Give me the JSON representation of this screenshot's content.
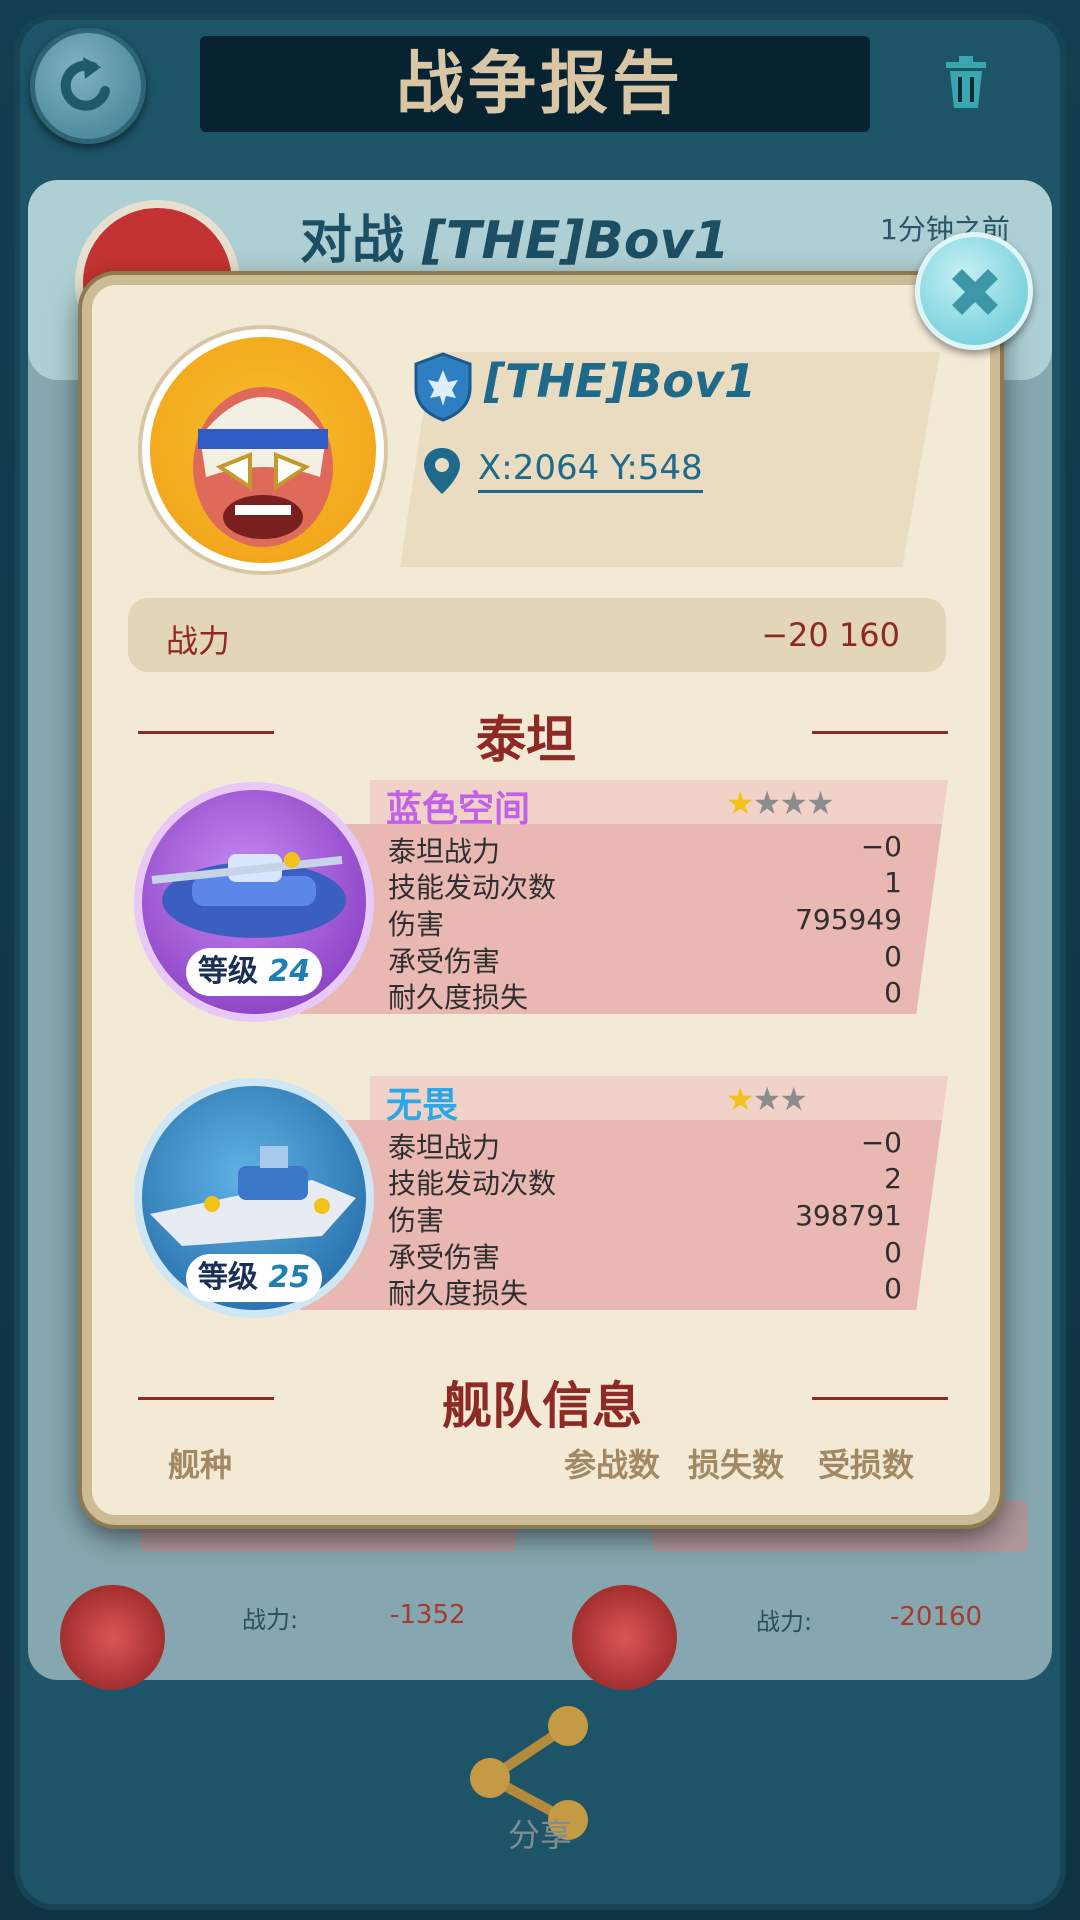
{
  "screen": {
    "title": "战争报告",
    "report_header": {
      "versus_prefix": "对战",
      "opponent": "[THE]Bov1",
      "time_ago": "1分钟之前"
    },
    "bottom_rows": [
      {
        "label": "战力:",
        "value": "-1352"
      },
      {
        "label": "战力:",
        "value": "-20160"
      }
    ],
    "share_label": "分享"
  },
  "popup": {
    "player_name": "[THE]Bov1",
    "coordinates": "X:2064 Y:548",
    "power_label": "战力",
    "power_value": "−20 160",
    "titan_section_title": "泰坦",
    "titans": [
      {
        "name": "蓝色空间",
        "name_color": "#c061e8",
        "stars_filled": 1,
        "stars_total": 4,
        "level_label": "等级",
        "level": "24",
        "stats": [
          {
            "label": "泰坦战力",
            "value": "−0"
          },
          {
            "label": "技能发动次数",
            "value": "1"
          },
          {
            "label": "伤害",
            "value": "795949"
          },
          {
            "label": "承受伤害",
            "value": "0"
          },
          {
            "label": "耐久度损失",
            "value": "0"
          }
        ]
      },
      {
        "name": "无畏",
        "name_color": "#2aa8e8",
        "stars_filled": 1,
        "stars_total": 3,
        "level_label": "等级",
        "level": "25",
        "stats": [
          {
            "label": "泰坦战力",
            "value": "−0"
          },
          {
            "label": "技能发动次数",
            "value": "2"
          },
          {
            "label": "伤害",
            "value": "398791"
          },
          {
            "label": "承受伤害",
            "value": "0"
          },
          {
            "label": "耐久度损失",
            "value": "0"
          }
        ]
      }
    ],
    "fleet_section_title": "舰队信息",
    "fleet_columns": {
      "type": "舰种",
      "participated": "参战数",
      "lost": "损失数",
      "damaged": "受损数"
    }
  },
  "colors": {
    "accent_red": "#8e2a25",
    "player_blue": "#1f6a8a",
    "star_gold": "#f2c21a",
    "star_gray": "#8c8c8c"
  }
}
